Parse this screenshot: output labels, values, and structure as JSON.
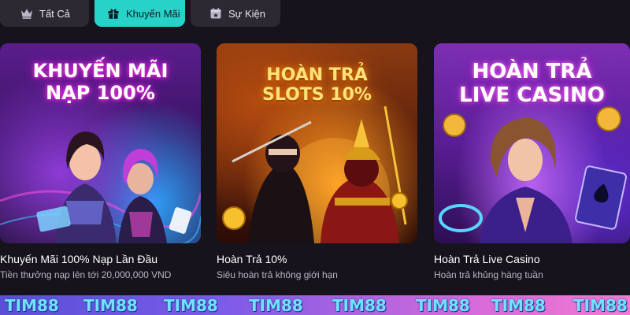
{
  "tabs": [
    {
      "label": "Tất Cả",
      "icon": "crown-icon",
      "active": false
    },
    {
      "label": "Khuyến Mãi",
      "icon": "gift-icon",
      "active": true
    },
    {
      "label": "Sự Kiện",
      "icon": "calendar-icon",
      "active": false
    }
  ],
  "colors": {
    "active_tab": "#27d3c9",
    "tab_bg": "#2c2933",
    "page_bg": "#16131c"
  },
  "cards": [
    {
      "headline": [
        "KHUYẾN MÃI",
        "NẠP 100%"
      ],
      "title": "Khuyến Mãi 100% Nạp Lần Đầu",
      "description": "Tiền thưởng nạp lên tới 20,000,000 VND"
    },
    {
      "headline": [
        "HOÀN TRẢ",
        "SLOTS 10%"
      ],
      "title": "Hoàn Trả 10%",
      "description": "Siêu hoàn trả không giới hạn"
    },
    {
      "headline": [
        "HOÀN TRẢ",
        "LIVE CASINO"
      ],
      "title": "Hoàn Trả Live Casino",
      "description": "Hoàn trả khủng hàng tuần"
    }
  ],
  "watermark": {
    "text": "TIM88",
    "repeats": [
      "TIM88",
      "TIM88",
      "TIM88",
      "TIM88",
      "TIM88",
      "TIM88",
      "TIM88",
      "TIM88"
    ]
  }
}
